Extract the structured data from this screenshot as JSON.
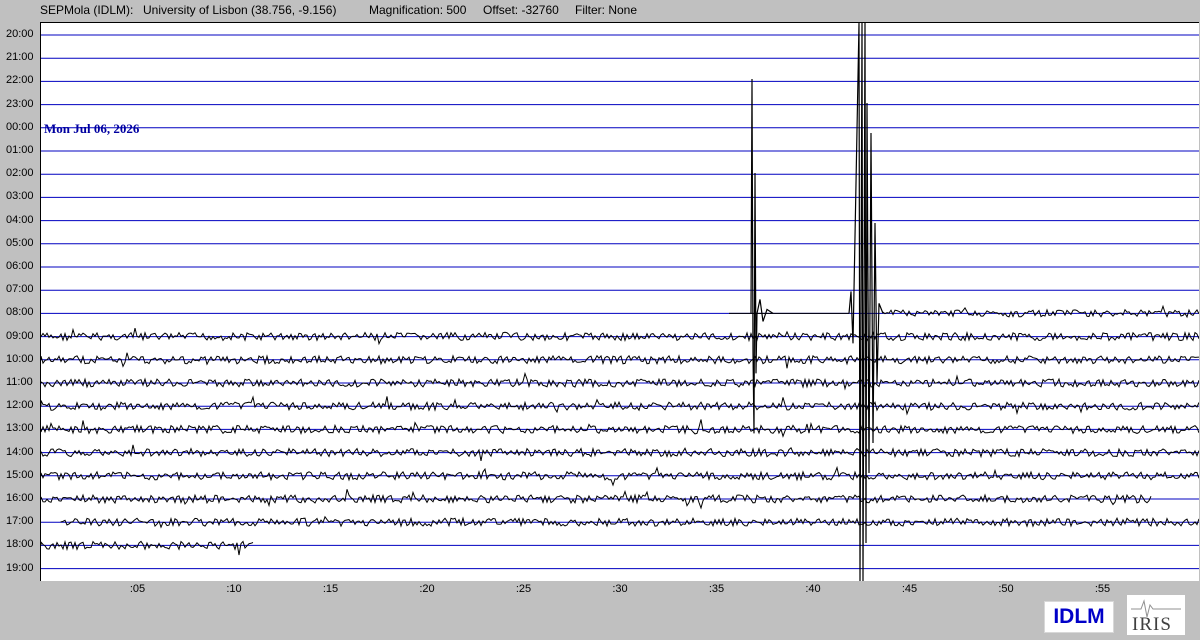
{
  "header": {
    "station": "SEPMola (IDLM):",
    "location": "University of Lisbon (38.756, -9.156)",
    "magnification": "Magnification: 500",
    "offset": "Offset: -32760",
    "filter": "Filter: None"
  },
  "date_label": "Mon Jul 06, 2026",
  "hour_labels": [
    "20:00",
    "21:00",
    "22:00",
    "23:00",
    "00:00",
    "01:00",
    "02:00",
    "03:00",
    "04:00",
    "05:00",
    "06:00",
    "07:00",
    "08:00",
    "09:00",
    "10:00",
    "11:00",
    "12:00",
    "13:00",
    "14:00",
    "15:00",
    "16:00",
    "17:00",
    "18:00",
    "19:00"
  ],
  "minute_labels": [
    ":05",
    ":10",
    ":15",
    ":20",
    ":25",
    ":30",
    ":35",
    ":40",
    ":45",
    ":50",
    ":55"
  ],
  "logos": {
    "network": "IDLM",
    "org": "IRIS"
  },
  "colors": {
    "gridline": "#0000c0",
    "trace": "#000000",
    "date": "#0000a0",
    "background": "#c0c0c0"
  }
}
